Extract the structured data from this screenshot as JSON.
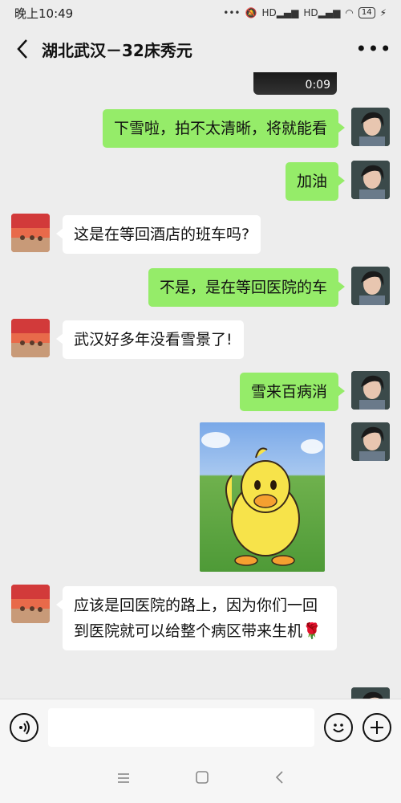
{
  "status_bar": {
    "time": "晚上10:49",
    "signal1": "HD",
    "signal2": "HD",
    "battery": "14"
  },
  "header": {
    "title": "湖北武汉－32床秀元"
  },
  "video": {
    "duration": "0:09"
  },
  "messages": [
    {
      "from": "me",
      "text": "下雪啦，拍不太清晰，将就能看"
    },
    {
      "from": "me",
      "text": "加油"
    },
    {
      "from": "other",
      "text": "这是在等回酒店的班车吗?"
    },
    {
      "from": "me",
      "text": "不是，是在等回医院的车"
    },
    {
      "from": "other",
      "text": "武汉好多年没看雪景了!"
    },
    {
      "from": "me",
      "text": "雪来百病消"
    },
    {
      "from": "other",
      "text": "应该是回医院的路上，因为你们一回到医院就可以给整个病区带来生机🌹"
    }
  ],
  "icons": {
    "back": "chevron-left-icon",
    "more": "more-icon",
    "voice": "voice-icon",
    "emoji": "emoji-icon",
    "add": "plus-icon",
    "nav_menu": "menu-icon",
    "nav_home": "home-icon",
    "nav_back": "back-icon"
  },
  "colors": {
    "my_bubble": "#95ec69",
    "other_bubble": "#ffffff",
    "background": "#ededed"
  }
}
